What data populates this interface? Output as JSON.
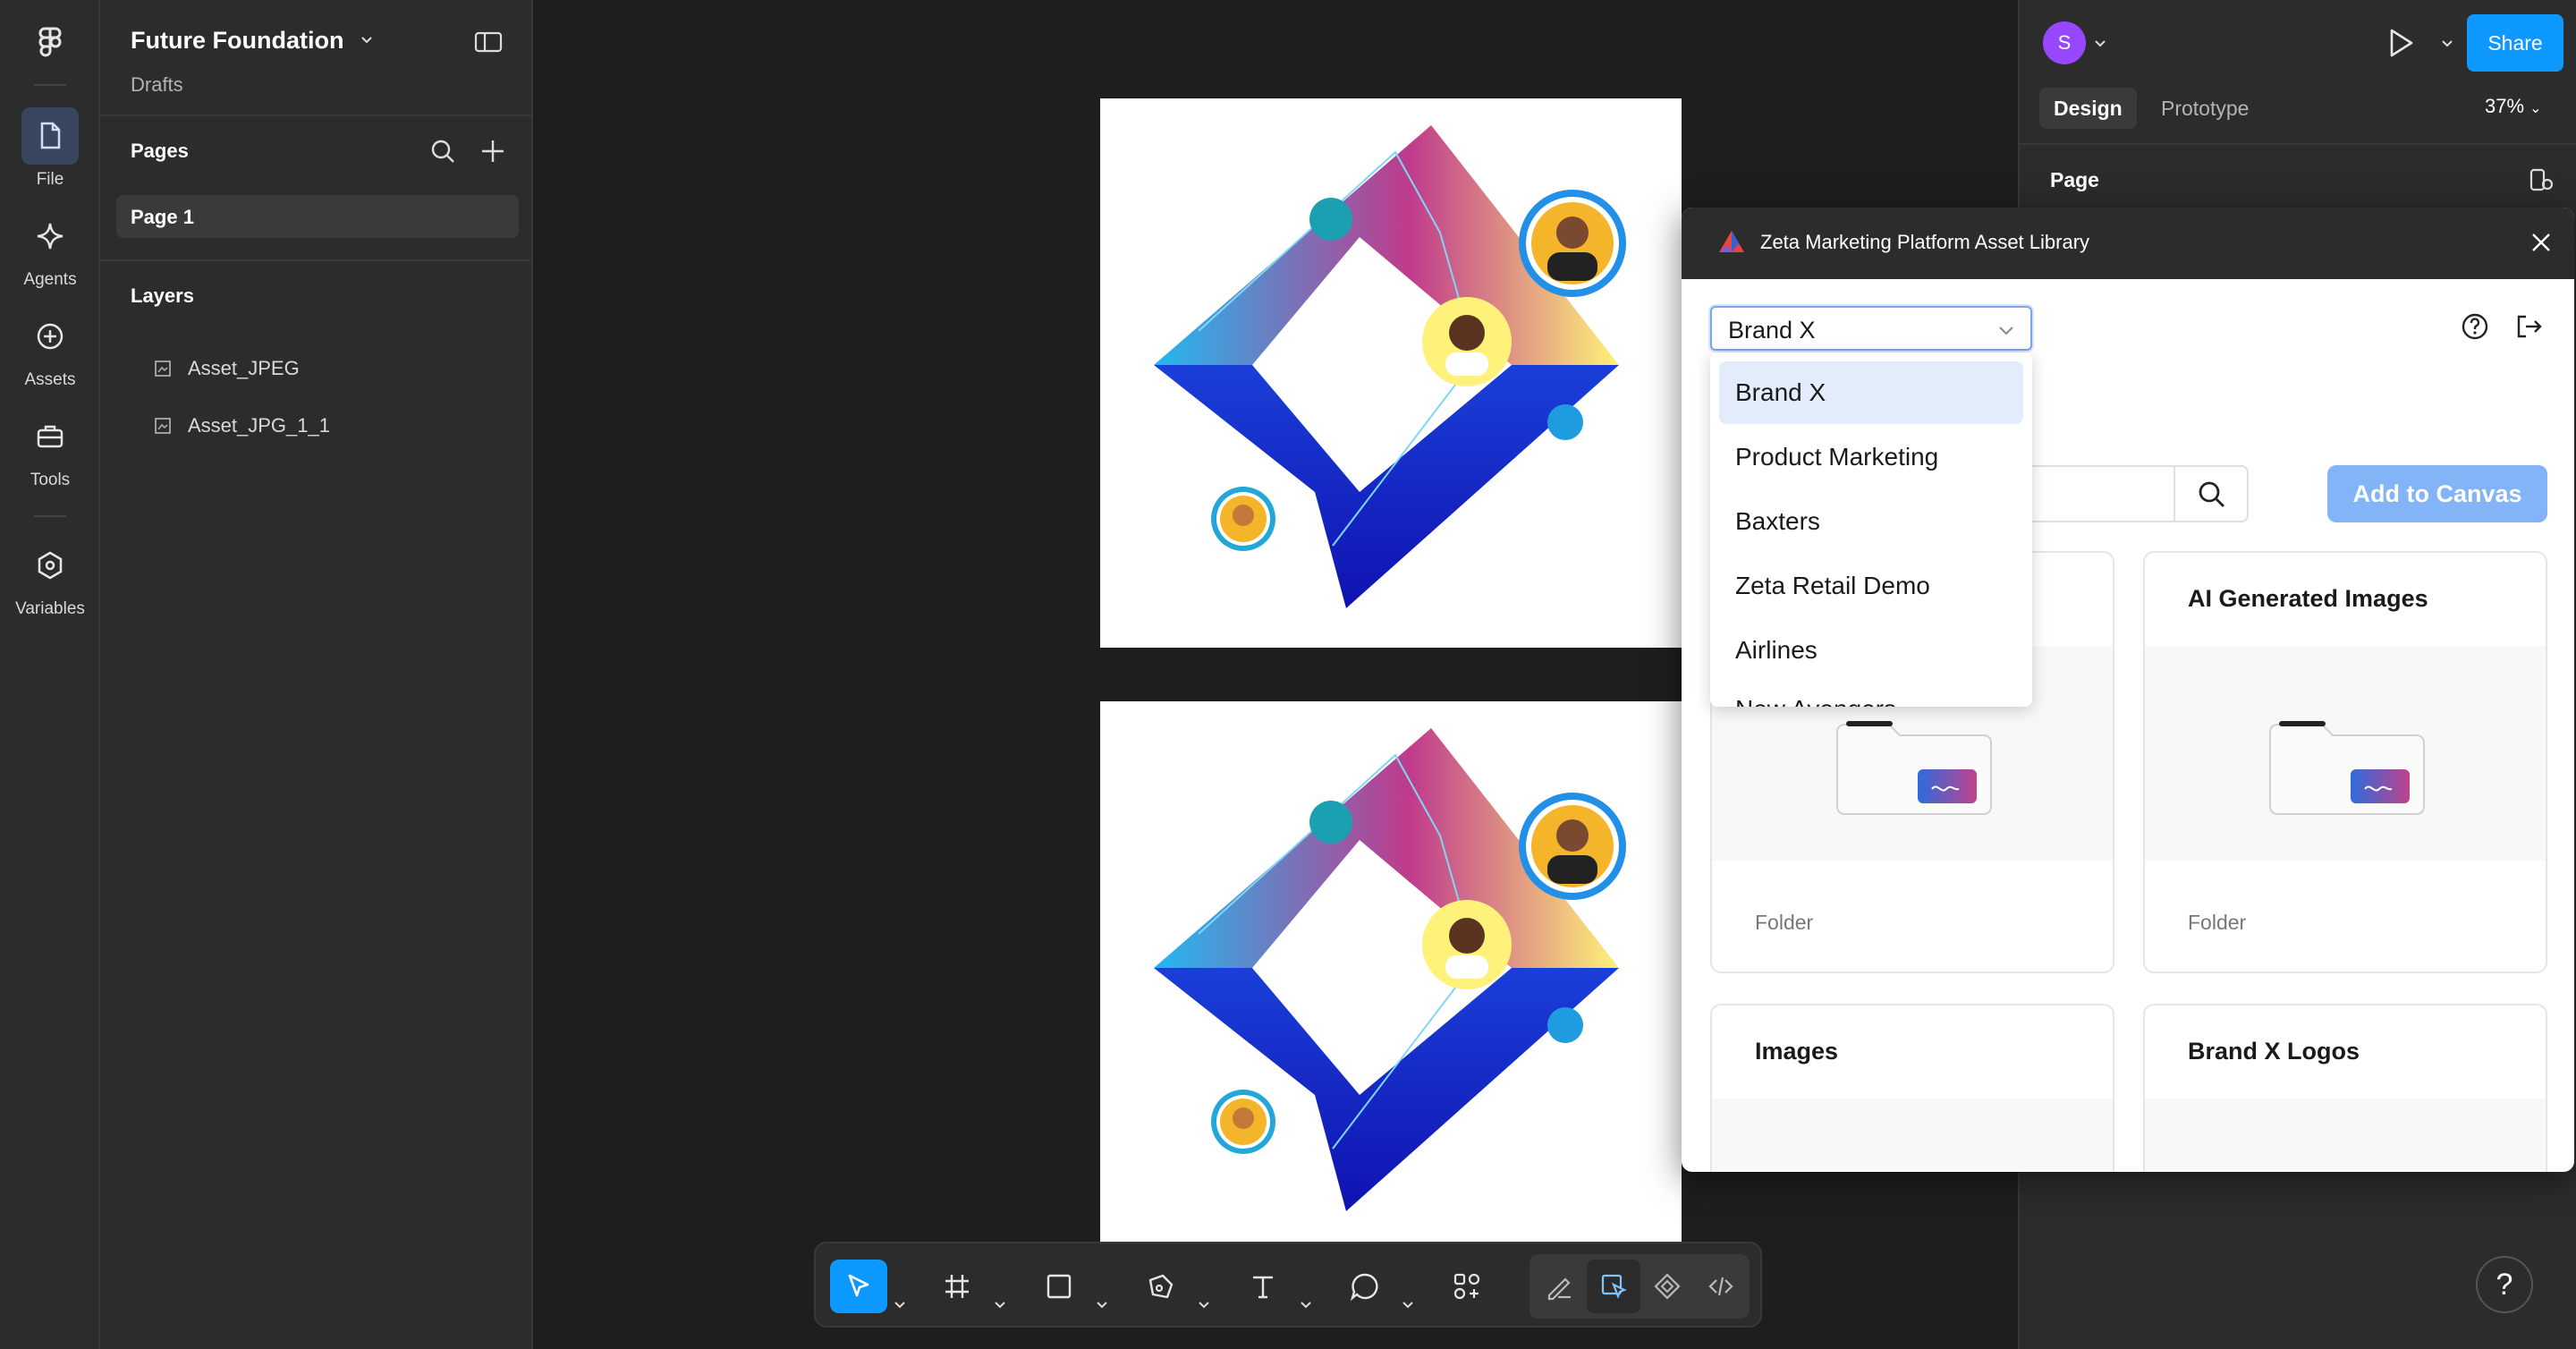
{
  "rail": {
    "items": [
      {
        "label": "File",
        "icon": "file-icon"
      },
      {
        "label": "Agents",
        "icon": "sparkle-icon"
      },
      {
        "label": "Assets",
        "icon": "plus-circle-icon"
      },
      {
        "label": "Tools",
        "icon": "toolbox-icon"
      },
      {
        "label": "Variables",
        "icon": "hexagon-icon"
      }
    ]
  },
  "project": {
    "name": "Future Foundation",
    "location": "Drafts"
  },
  "pages": {
    "title": "Pages",
    "items": [
      {
        "label": "Page 1"
      }
    ]
  },
  "layers": {
    "title": "Layers",
    "items": [
      {
        "label": "Asset_JPEG"
      },
      {
        "label": "Asset_JPG_1_1"
      }
    ]
  },
  "header": {
    "avatar_initial": "S",
    "share_label": "Share"
  },
  "design": {
    "tabs": [
      "Design",
      "Prototype"
    ],
    "zoom": "37%",
    "page_section": "Page"
  },
  "plugin": {
    "title": "Zeta Marketing Platform Asset Library",
    "selected_brand": "Brand X",
    "brand_options": [
      "Brand X",
      "Product Marketing",
      "Baxters",
      "Zeta Retail Demo",
      "Airlines",
      "New Avengers"
    ],
    "add_to_canvas": "Add to Canvas",
    "cards": [
      {
        "title": "",
        "type": "Folder"
      },
      {
        "title": "AI Generated Images",
        "type": "Folder"
      },
      {
        "title": "Images",
        "type": ""
      },
      {
        "title": "Brand X Logos",
        "type": ""
      }
    ]
  },
  "help_label": "?",
  "colors": {
    "accent": "#0d99ff",
    "avatar": "#9747ff",
    "add_button": "#83b4f7"
  }
}
